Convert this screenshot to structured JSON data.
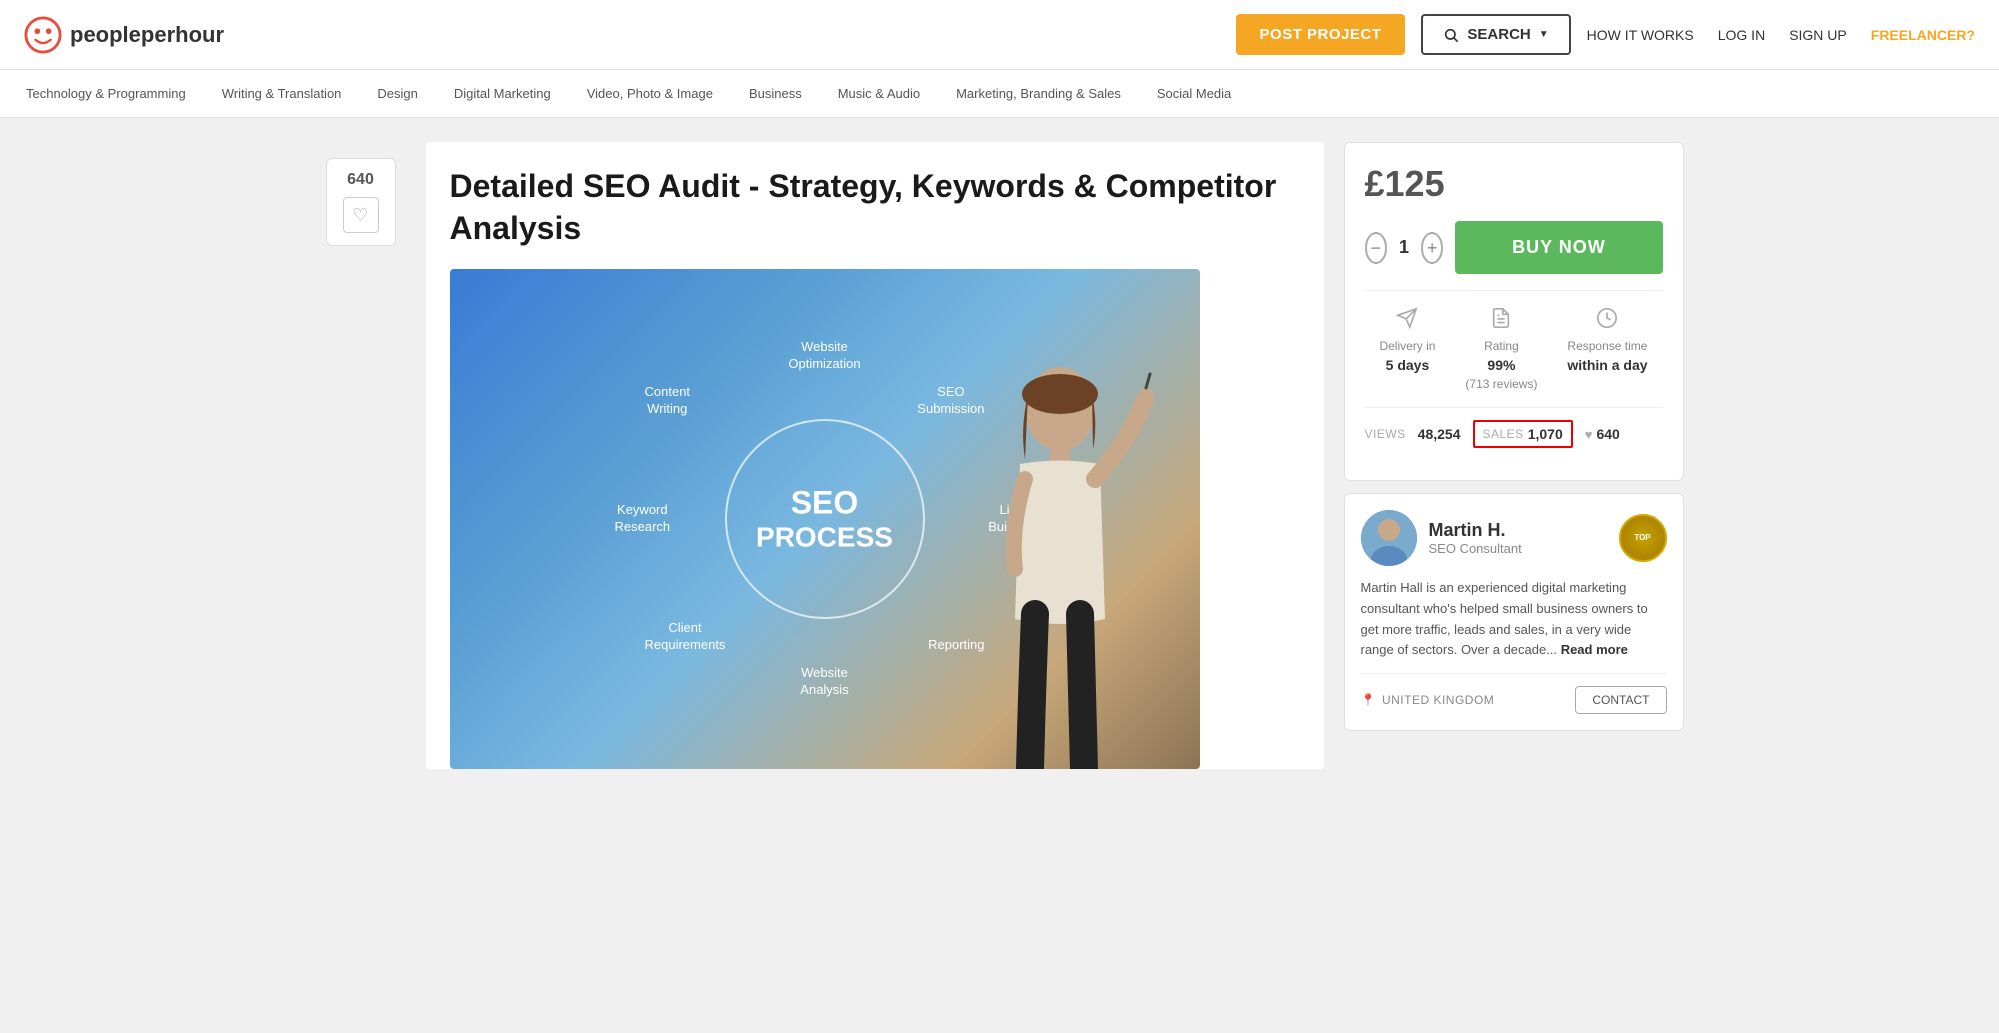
{
  "header": {
    "logo_text_normal": "people",
    "logo_text_bold": "perhour",
    "post_project_label": "POST PROJECT",
    "search_label": "SEARCH",
    "how_it_works_label": "HOW IT WORKS",
    "login_label": "LOG IN",
    "signup_label": "SIGN UP",
    "freelancer_label": "FREELANCER?"
  },
  "categories": [
    "Technology & Programming",
    "Writing & Translation",
    "Design",
    "Digital Marketing",
    "Video, Photo & Image",
    "Business",
    "Music & Audio",
    "Marketing, Branding & Sales",
    "Social Media"
  ],
  "product": {
    "title": "Detailed SEO Audit - Strategy, Keywords & Competitor Analysis",
    "price": "£125",
    "quantity": "1",
    "buy_now_label": "BUY NOW",
    "delivery_label": "Delivery in",
    "delivery_value": "5 days",
    "rating_label": "Rating",
    "rating_value": "99%",
    "rating_reviews": "(713 reviews)",
    "response_label": "Response time",
    "response_value": "within a day",
    "views_label": "VIEWS",
    "views_value": "48,254",
    "sales_label": "SALES",
    "sales_value": "1,070",
    "likes_value": "640"
  },
  "seller": {
    "name": "Martin H.",
    "title": "SEO Consultant",
    "badge_label": "TOP",
    "location": "UNITED KINGDOM",
    "bio": "Martin Hall is an experienced digital marketing consultant who's helped small business owners to get more traffic, leads and sales, in a very wide range of sectors. Over a decade...",
    "read_more_label": "Read more",
    "contact_label": "CONTACT"
  },
  "sidebar": {
    "likes_count": "640"
  },
  "diagram": {
    "center_seo": "SEO",
    "center_process": "PROCESS",
    "labels": [
      "Website Optimization",
      "SEO Submission",
      "Link Building",
      "Reporting",
      "Website Analysis",
      "Client Requirements",
      "Keyword Research",
      "Content Writing"
    ]
  }
}
